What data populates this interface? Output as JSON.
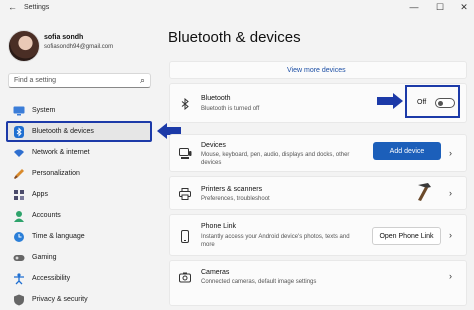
{
  "window": {
    "title": "Settings",
    "back": "←",
    "minimize": "—",
    "maximize": "☐",
    "close": "✕"
  },
  "profile": {
    "name": "sofia sondh",
    "email": "sofiasondh94@gmail.com"
  },
  "search": {
    "placeholder": "Find a setting"
  },
  "nav": [
    {
      "label": "System",
      "icon": "monitor-icon",
      "color": "#3b7dd8"
    },
    {
      "label": "Bluetooth & devices",
      "icon": "bluetooth-icon",
      "color": "#1f6fd1",
      "active": true
    },
    {
      "label": "Network & internet",
      "icon": "wifi-icon",
      "color": "#2f6fcf"
    },
    {
      "label": "Personalization",
      "icon": "brush-icon",
      "color": "#d98a2b"
    },
    {
      "label": "Apps",
      "icon": "apps-icon",
      "color": "#4a4a6a"
    },
    {
      "label": "Accounts",
      "icon": "person-icon",
      "color": "#2ea36b"
    },
    {
      "label": "Time & language",
      "icon": "globe-clock-icon",
      "color": "#2b7fd8"
    },
    {
      "label": "Gaming",
      "icon": "gamepad-icon",
      "color": "#555"
    },
    {
      "label": "Accessibility",
      "icon": "accessibility-icon",
      "color": "#1f6fd1"
    },
    {
      "label": "Privacy & security",
      "icon": "shield-icon",
      "color": "#555"
    }
  ],
  "page": {
    "title": "Bluetooth & devices",
    "view_more": "View more devices"
  },
  "bluetooth": {
    "title": "Bluetooth",
    "subtitle": "Bluetooth is turned off",
    "state": "Off"
  },
  "devices": {
    "title": "Devices",
    "subtitle_1": "Mouse, keyboard, pen, audio, displays and docks, other",
    "subtitle_2": "devices",
    "button": "Add device"
  },
  "printers": {
    "title": "Printers & scanners",
    "subtitle": "Preferences, troubleshoot"
  },
  "phone": {
    "title": "Phone Link",
    "subtitle_1": "Instantly access your Android device's photos, texts and",
    "subtitle_2": "more",
    "button": "Open Phone Link"
  },
  "cameras": {
    "title": "Cameras",
    "subtitle": "Connected cameras, default image settings"
  },
  "colors": {
    "accent": "#1c5fba",
    "highlight": "#1c3aa8"
  }
}
